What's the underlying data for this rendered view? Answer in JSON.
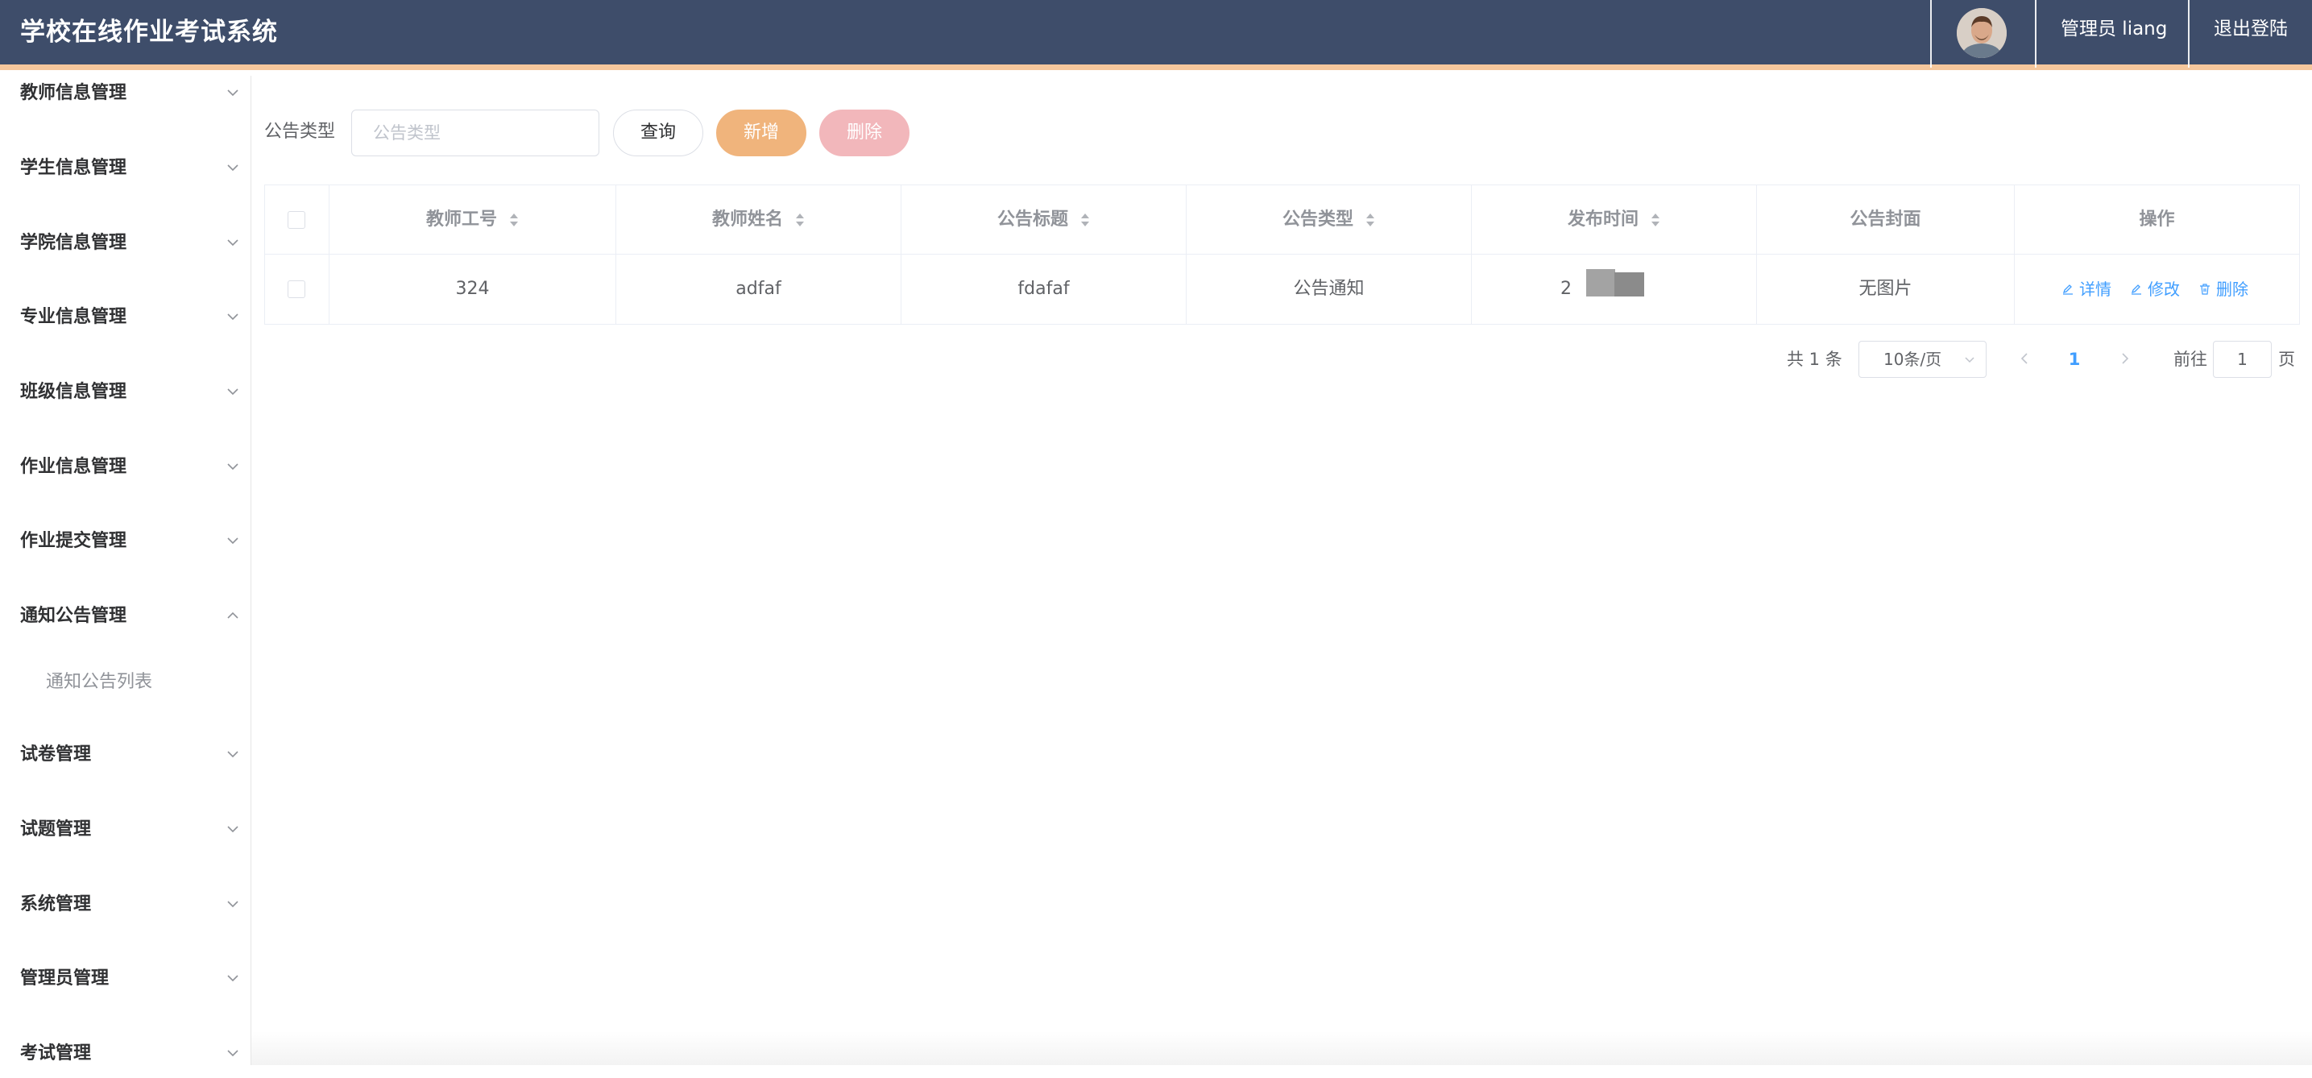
{
  "header": {
    "app_title": "学校在线作业考试系统",
    "user_label": "管理员 liang",
    "logout_label": "退出登陆"
  },
  "sidebar": {
    "items": [
      {
        "label": "教师信息管理",
        "expanded": false
      },
      {
        "label": "学生信息管理",
        "expanded": false
      },
      {
        "label": "学院信息管理",
        "expanded": false
      },
      {
        "label": "专业信息管理",
        "expanded": false
      },
      {
        "label": "班级信息管理",
        "expanded": false
      },
      {
        "label": "作业信息管理",
        "expanded": false
      },
      {
        "label": "作业提交管理",
        "expanded": false
      },
      {
        "label": "通知公告管理",
        "expanded": true
      },
      {
        "label": "试卷管理",
        "expanded": false
      },
      {
        "label": "试题管理",
        "expanded": false
      },
      {
        "label": "系统管理",
        "expanded": false
      },
      {
        "label": "管理员管理",
        "expanded": false
      },
      {
        "label": "考试管理",
        "expanded": false
      }
    ],
    "sub_item": "通知公告列表"
  },
  "toolbar": {
    "filter_label": "公告类型",
    "filter_placeholder": "公告类型",
    "query_label": "查询",
    "add_label": "新增",
    "delete_label": "删除"
  },
  "table": {
    "headers": [
      "教师工号",
      "教师姓名",
      "公告标题",
      "公告类型",
      "发布时间",
      "公告封面",
      "操作"
    ],
    "rows": [
      {
        "teacher_id": "324",
        "teacher_name": "adfaf",
        "title": "fdafaf",
        "type": "公告通知",
        "publish_time_visible": "2",
        "cover": "无图片"
      }
    ],
    "actions": {
      "detail": "详情",
      "edit": "修改",
      "delete": "删除"
    }
  },
  "pagination": {
    "total_label": "共 1 条",
    "page_size": "10条/页",
    "current_page": "1",
    "goto_label": "前往",
    "goto_value": "1",
    "page_suffix": "页"
  },
  "colors": {
    "header_bg": "#3e4d6a",
    "header_accent": "#f5c79c",
    "primary_link": "#409eff",
    "add_button": "#f0b47c",
    "delete_button": "#f2b7bb"
  }
}
